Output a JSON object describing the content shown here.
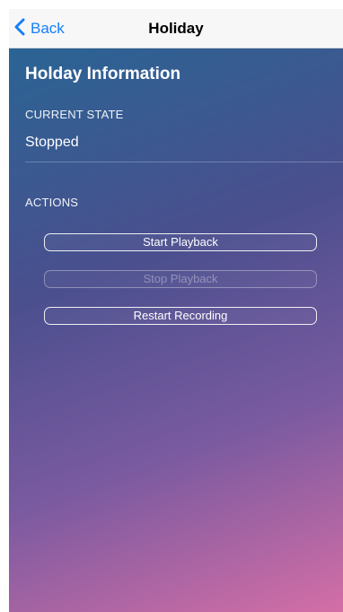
{
  "navbar": {
    "back_label": "Back",
    "title": "Holiday"
  },
  "info": {
    "heading": "Holday Information",
    "current_state_label": "CURRENT STATE",
    "current_state_value": "Stopped"
  },
  "actions": {
    "label": "ACTIONS",
    "buttons": [
      {
        "label": "Start Playback",
        "enabled": true
      },
      {
        "label": "Stop Playback",
        "enabled": false
      },
      {
        "label": "Restart Recording",
        "enabled": true
      }
    ]
  },
  "colors": {
    "accent": "#157efb",
    "gradient_start": "#2a6494",
    "gradient_end": "#d46ea6"
  },
  "icons": {
    "back": "chevron-left-icon"
  }
}
